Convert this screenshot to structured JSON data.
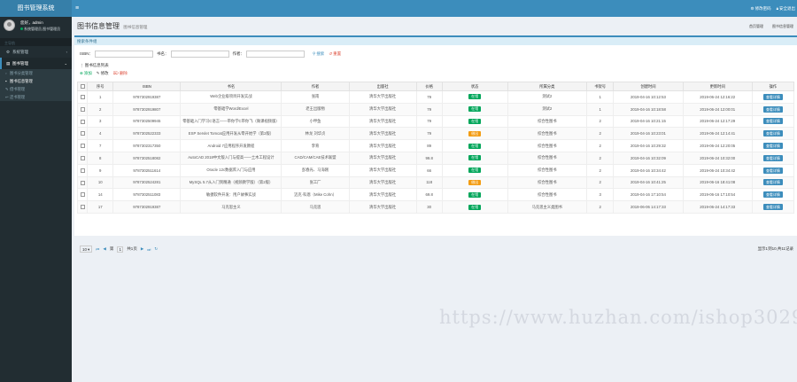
{
  "app": {
    "title": "图书管理系统"
  },
  "topbar": {
    "toggle_icon": "menu-icon",
    "change_password": "修改密码",
    "logout": "安全退出"
  },
  "user": {
    "greeting": "您好，admin",
    "role": "系统管理员,图书管理员"
  },
  "sidebar": {
    "header": "主导航",
    "items": [
      {
        "label": "系统管理",
        "icon": "gear-icon",
        "active": false
      },
      {
        "label": "图书管理",
        "icon": "book-icon",
        "active": true
      }
    ],
    "sub_items": [
      {
        "label": "图书分类管理",
        "icon": "folder-icon",
        "active": false
      },
      {
        "label": "图书信息管理",
        "icon": "book-icon",
        "active": true
      },
      {
        "label": "借书管理",
        "icon": "bookmark-icon",
        "active": false
      },
      {
        "label": "还书管理",
        "icon": "return-icon",
        "active": false
      }
    ]
  },
  "header": {
    "title": "图书信息管理",
    "subtitle": "图书信息管理",
    "right_links": [
      "首页管理",
      "图书信息管理"
    ]
  },
  "search": {
    "title": "搜索条件组",
    "isbn_label": "ISBN：",
    "name_label": "书名：",
    "author_label": "作者：",
    "search_button": "搜索",
    "reset_button": "重置"
  },
  "list": {
    "title": "图书信息列表",
    "add_label": "添加",
    "edit_label": "修改",
    "delete_label": "删除",
    "columns": [
      "序号",
      "ISBN",
      "书名",
      "作者",
      "出版社",
      "价格",
      "状态",
      "所属分类",
      "书架号",
      "创建时间",
      "更新时间",
      "操作"
    ],
    "rows": [
      {
        "no": "1",
        "isbn": "9787302919387",
        "name": "Web企业级项目开发实战",
        "author": "张南",
        "press": "清华大学出版社",
        "price": "79",
        "status": "在馆",
        "category": "测试2",
        "shelf": "1",
        "created": "2019-04-16 10:12:53",
        "updated": "2019-06-24 12:16:22",
        "action": "查看详情"
      },
      {
        "no": "2",
        "isbn": "9787302919807",
        "name": "零基础学Word/Excel",
        "author": "老王出版物",
        "press": "清华大学出版社",
        "price": "79",
        "status": "在馆",
        "category": "测试2",
        "shelf": "1",
        "created": "2019-04-16 10:18:58",
        "updated": "2019-06-24 12:00:01",
        "action": "查看详情"
      },
      {
        "no": "3",
        "isbn": "9787302509945",
        "name": "零基础入门学习C语言——带你学C带你飞（微课视频版）",
        "author": "小甲鱼",
        "press": "清华大学出版社",
        "price": "79",
        "status": "在馆",
        "category": "综合性图书",
        "shelf": "2",
        "created": "2019-04-16 10:21:15",
        "updated": "2019-06-24 12:17:29",
        "action": "查看详情"
      },
      {
        "no": "4",
        "isbn": "9787302522333",
        "name": "ESP Servlet Tomcat应用开发从零开始学（第2版）",
        "author": "林龙 刘华贞",
        "press": "清华大学出版社",
        "price": "79",
        "status": "借出",
        "category": "综合性图书",
        "shelf": "2",
        "created": "2019-04-16 10:23:01",
        "updated": "2019-06-24 12:14:41",
        "action": "查看详情"
      },
      {
        "no": "7",
        "isbn": "9787302317350",
        "name": "Android 7应用程序开发教程",
        "author": "李育",
        "press": "清华大学出版社",
        "price": "89",
        "status": "在馆",
        "category": "综合性图书",
        "shelf": "2",
        "created": "2019-04-16 10:29:32",
        "updated": "2019-06-24 12:20:05",
        "action": "查看详情"
      },
      {
        "no": "8",
        "isbn": "9787302518082",
        "name": "AutoCAD 2018中文版入门与提高——土木工程设计",
        "author": "CAD/CAM/CAE技术联盟",
        "press": "清华大学出版社",
        "price": "99.8",
        "status": "在馆",
        "category": "综合性图书",
        "shelf": "2",
        "created": "2019-04-16 10:32:09",
        "updated": "2019-06-24 10:32:00",
        "action": "查看详情"
      },
      {
        "no": "9",
        "isbn": "9787302511614",
        "name": "Oracle 12c数据库入门与应用",
        "author": "彭春光、马海刚",
        "press": "清华大学出版社",
        "price": "66",
        "status": "在馆",
        "category": "综合性图书",
        "shelf": "2",
        "created": "2019-04-16 10:34:42",
        "updated": "2019-06-24 10:34:42",
        "action": "查看详情"
      },
      {
        "no": "10",
        "isbn": "9787302524281",
        "name": "MySQL 5.7从入门到精通（视频教学版）（第2版）",
        "author": "张工厂",
        "press": "清华大学出版社",
        "price": "118",
        "status": "借出",
        "category": "综合性图书",
        "shelf": "2",
        "created": "2019-04-16 10:41:25",
        "updated": "2019-06-16 18:41:08",
        "action": "查看详情"
      },
      {
        "no": "14",
        "isbn": "9787302511083",
        "name": "敏捷软件开发：用户故事实战",
        "author": "迈克·科恩（Mike Cohn）",
        "press": "清华大学出版社",
        "price": "69.8",
        "status": "在馆",
        "category": "综合性图书",
        "shelf": "3",
        "created": "2019-04-16 17:10:54",
        "updated": "2019-06-16 17:10:54",
        "action": "查看详情"
      },
      {
        "no": "17",
        "isbn": "9787302919387",
        "name": "马克思主义",
        "author": "马克思",
        "press": "清华大学出版社",
        "price": "30",
        "status": "在馆",
        "category": "马克思主义类图书",
        "shelf": "2",
        "created": "2019-06-06 14:17:33",
        "updated": "2019-06-24 14:17:33",
        "action": "查看详情"
      }
    ]
  },
  "pager": {
    "page_size": "10",
    "page_label_prefix": "第",
    "page_current": "1",
    "page_label_suffix": "共1页",
    "info": "显示1到10,共11记录"
  },
  "watermark": "https://www.huzhan.com/ishop30295",
  "colors": {
    "header_blue": "#3c8dbc",
    "sidebar_dark": "#222d32",
    "status_in": "#00a65a",
    "status_out": "#f39c12"
  }
}
